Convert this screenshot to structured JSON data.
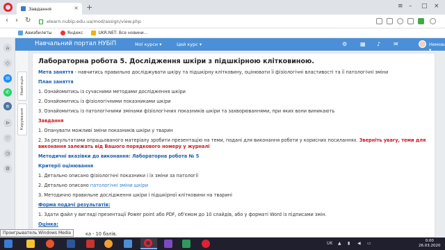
{
  "browser": {
    "tab_title": "Завдання",
    "url": "elearn.nubip.edu.ua/mod/assign/view.php",
    "bookmarks": [
      "Авиабилеты",
      "Яндекс",
      "UKR.NET: Все новини..."
    ]
  },
  "navbar": {
    "portal_title": "Навчальний портал НУБіП",
    "my_courses": "Мої курси ▾",
    "this_course": "Цей курс ▾",
    "user_name": "Немова ▾"
  },
  "drawer": {
    "tab1": "Навігація",
    "tab2": "Керування"
  },
  "content": {
    "title": "Лабораторна робота 5. Дослідження шкіри з підшкірною клітковиною.",
    "goal_label": "Мета заняття",
    "goal_text": " - навчитись правильно досліджувати шкіру та підшкірну клітковину, оцінювати її фізіологічні властивості та її патологічні зміни",
    "plan_label": "План заняття",
    "plan": [
      "1. Ознайомитись із сучасними методами дослідження шкіри",
      "2. Ознайомитись із  фізіологічними показниками шкіри",
      "3.  Ознайомитись із патологічними змінами фізіологічних показників шкіри та захворюваннями, при яких вони виникають"
    ],
    "tasks_label": "Завдання",
    "task1": "1. Опанувати  можливі зміни показників шкіри у тварин",
    "task2_text": "2. За результатами опрацьованого матеріалу зробити презентацію на теми, подані для виконання роботи у корисних посиланнях. ",
    "task2_red": "Зверніть увагу, теми для виконання залежать від Вашого порядкового номеру у журналі",
    "method_label": "Методичні вказівки до виконання: Лабораторна робота № 5",
    "criteria_label": "Критерії оцінювання",
    "criteria1": "1. Детально описано фізіологічні показники і їх зміни за патології",
    "criteria2_pre": "2. Детально описано ",
    "criteria2_link": "патологічні зміни шкіри",
    "criteria3": "3. Методично правильне дослідження шкіри і підшкірної клітковини  на тварині",
    "form_label": "Форма подачі результатів:",
    "form_text": "1. Здати файл у вигляді презентації Power point або PDF, об'ємом до 10 слайдів, або у форматі Word із підписами змін.",
    "grade_label": "Оцінка:",
    "grade_text": "ка - 10 балів."
  },
  "taskbar": {
    "tooltip": "Проигрыватель Windows Media",
    "lang": "UK",
    "time": "0:00",
    "date": "26.03.2020"
  },
  "colors": {
    "navbar": "#4a8fd8",
    "link": "#1a5fae",
    "warning": "#d0171e"
  }
}
